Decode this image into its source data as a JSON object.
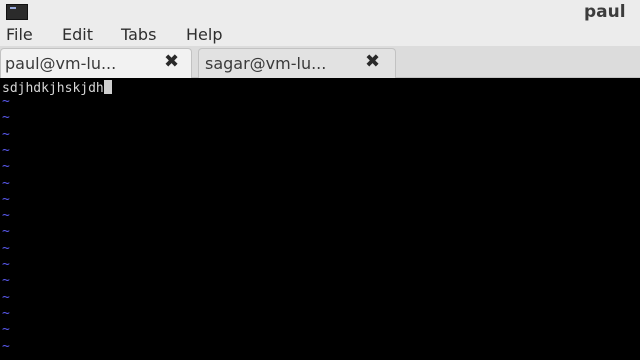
{
  "window": {
    "title": "paul",
    "app_icon": "terminal-icon"
  },
  "menu": {
    "items": [
      "File",
      "Edit",
      "Tabs",
      "Help"
    ]
  },
  "tabs": [
    {
      "label": "paul@vm-lu...",
      "close": "✖",
      "active": true
    },
    {
      "label": "sagar@vm-lu...",
      "close": "✖",
      "active": false
    }
  ],
  "editor": {
    "first_line": "sdjhdkjhskjdh",
    "empty_line_marker": "~",
    "empty_line_count": 16,
    "tilde_color": "#5a5af0"
  }
}
